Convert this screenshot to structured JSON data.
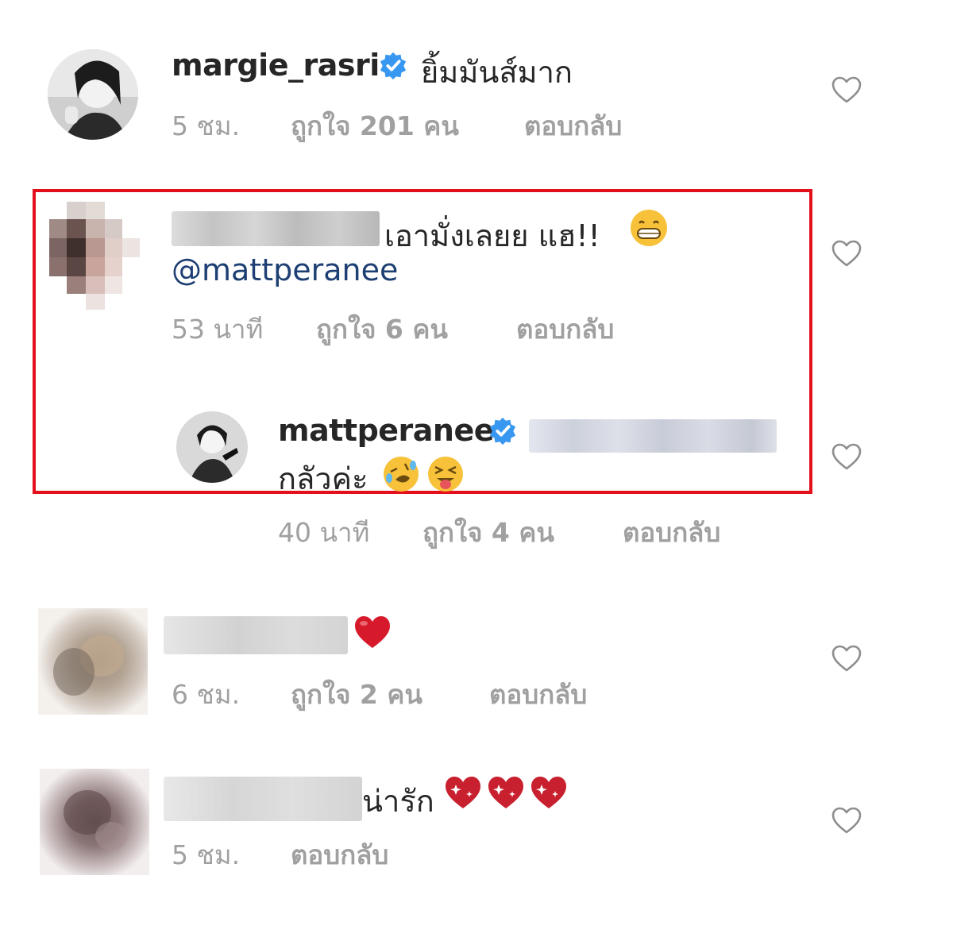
{
  "comments": [
    {
      "username": "margie_rasri",
      "verified": true,
      "text": "ยิ้มมันส์มาก",
      "time": "5 ชม.",
      "likes": "ถูกใจ 201 คน",
      "reply": "ตอบกลับ"
    },
    {
      "text": "เอามั่งเลยย แฮ!!",
      "mention": "@mattperanee",
      "time": "53 นาที",
      "likes": "ถูกใจ 6 คน",
      "reply": "ตอบกลับ",
      "replies": [
        {
          "username": "mattperanee",
          "verified": true,
          "text": "กลัวค่ะ",
          "time": "40 นาที",
          "likes": "ถูกใจ 4 คน",
          "reply": "ตอบกลับ"
        }
      ]
    },
    {
      "time": "6 ชม.",
      "likes": "ถูกใจ 2 คน",
      "reply": "ตอบกลับ"
    },
    {
      "text": "น่ารัก",
      "time": "5 ชม.",
      "reply": "ตอบกลับ"
    }
  ],
  "colors": {
    "highlight": "#e3101c",
    "verified": "#3897f0",
    "mention": "#1e3f73",
    "meta": "#a0a0a0",
    "heart": "#d61a2b"
  },
  "icons": {
    "like": "heart-outline-icon",
    "verified": "verified-badge-icon"
  }
}
